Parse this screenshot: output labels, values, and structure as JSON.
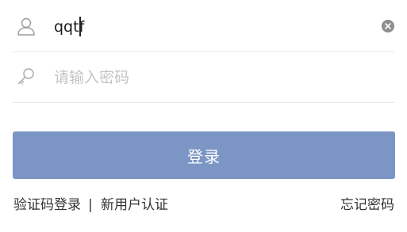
{
  "form": {
    "username": {
      "value": "qqtf",
      "icon": "user-icon",
      "clear_icon": "clear-icon"
    },
    "password": {
      "placeholder": "请输入密码",
      "icon": "key-icon"
    },
    "login_label": "登录"
  },
  "links": {
    "sms_login": "验证码登录",
    "separator": "|",
    "register": "新用户认证",
    "forgot_password": "忘记密码"
  },
  "colors": {
    "button_bg": "#7b95c4",
    "divider": "#e8e8e8",
    "placeholder": "#c4c4c4",
    "icon": "#9a9a9a"
  }
}
